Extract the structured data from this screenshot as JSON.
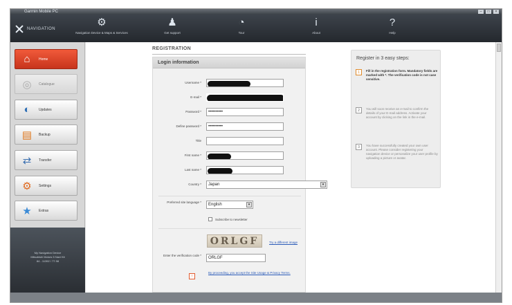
{
  "window": {
    "title": "Garmin Mobile PC"
  },
  "toolbar": {
    "logo_text": "NAVIGATION",
    "items": [
      {
        "label": "Navigation Device & Maps & Services",
        "icon": "satellite-icon"
      },
      {
        "label": "Get support",
        "icon": "user-icon"
      },
      {
        "label": "Tour",
        "icon": "clock-icon"
      },
      {
        "label": "About",
        "icon": "info-icon"
      },
      {
        "label": "Help",
        "icon": "help-icon"
      }
    ]
  },
  "sidebar": {
    "items": [
      {
        "label": "Home",
        "icon": "house-icon",
        "state": "active"
      },
      {
        "label": "Catalogue",
        "icon": "disc-icon",
        "state": "disabled"
      },
      {
        "label": "Updates",
        "icon": "globe-icon",
        "state": "normal"
      },
      {
        "label": "Backup",
        "icon": "document-icon",
        "state": "normal"
      },
      {
        "label": "Transfer",
        "icon": "transfer-icon",
        "state": "normal"
      },
      {
        "label": "Settings",
        "icon": "settings-icon",
        "state": "normal"
      },
      {
        "label": "Extras",
        "icon": "star-icon",
        "state": "normal"
      }
    ],
    "footer": "My Navigation Device\nMitsubishi Motors 5 Navi Kit\n84 - 11392 / 77.98"
  },
  "registration": {
    "heading": "REGISTRATION",
    "panel_title": "Login information",
    "fields": [
      {
        "label": "Username *",
        "value": "",
        "redacted": true
      },
      {
        "label": "E-mail *",
        "value": "",
        "redacted": true
      },
      {
        "label": "Password *",
        "value": "••••••••••"
      },
      {
        "label": "Define password *",
        "value": "••••••••••"
      },
      {
        "label": "Title",
        "value": ""
      },
      {
        "label": "First name *",
        "value": "",
        "redacted": true
      },
      {
        "label": "Last name *",
        "value": "",
        "redacted": true
      },
      {
        "label": "Country *",
        "value": "Japan",
        "type": "select"
      }
    ],
    "language_label": "Preferred site language *",
    "language_value": "English",
    "newsletter_label": "Subscribe to newsletter",
    "captcha_text": "ORLGF",
    "captcha_link": "Try a different image",
    "verification_label": "Enter the verification code *",
    "verification_value": "ORLGF",
    "terms_text": "By proceeding, you accept the Site Usage & Privacy Terms."
  },
  "steps": {
    "title": "Register in 3 easy steps:",
    "items": [
      {
        "num": "1",
        "text": "Fill in the registration form. Mandatory fields are marked with *. The verification code is not case sensitive.",
        "highlight": true
      },
      {
        "num": "2",
        "text": "You will soon receive an e-mail to confirm the details of your E-mail address. Activate your account by clicking on the link in the e-mail.",
        "highlight": false
      },
      {
        "num": "3",
        "text": "You have successfully created your own user account. Please consider registering your navigation device or personalize your user profile by uploading a picture or avatar.",
        "highlight": false
      }
    ]
  },
  "colors": {
    "accent": "#e0482a",
    "toolbar": "#2c3136",
    "link": "#2a5ab8"
  }
}
